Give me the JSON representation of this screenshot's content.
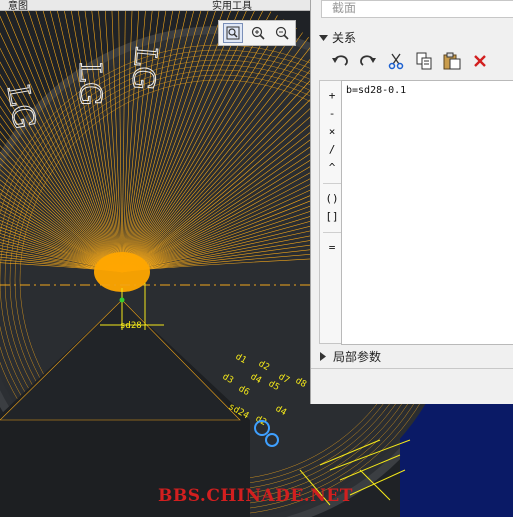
{
  "topbar": {
    "left_label": "意图",
    "middle_label": "实用工具"
  },
  "view_toolbar": {
    "icons": [
      "zoom-fit-icon",
      "zoom-in-icon",
      "zoom-out-icon"
    ]
  },
  "canvas": {
    "dimension_main": "sd28",
    "big_labels": [
      "LG",
      "LG",
      "LG"
    ],
    "small_labels": [
      "d1",
      "d2",
      "d3",
      "d4",
      "d5",
      "d6",
      "d7",
      "d8",
      "sd24",
      "d2",
      "d4"
    ],
    "colors": {
      "background": "#1f2226",
      "curves": "#f0a51a",
      "dims": "#f4e81a"
    }
  },
  "relations_panel": {
    "header_placeholder": "截面",
    "section_title": "关系",
    "toolbar_icons": [
      "undo-icon",
      "redo-icon",
      "cut-icon",
      "copy-icon",
      "paste-icon",
      "delete-icon"
    ],
    "operators": [
      "+",
      "-",
      "×",
      "/",
      "^",
      "()",
      "[]",
      "="
    ],
    "relation_text": "b=sd28-0.1",
    "local_params_label": "局部参数"
  },
  "watermark": "BBS.CHINADE.NET"
}
